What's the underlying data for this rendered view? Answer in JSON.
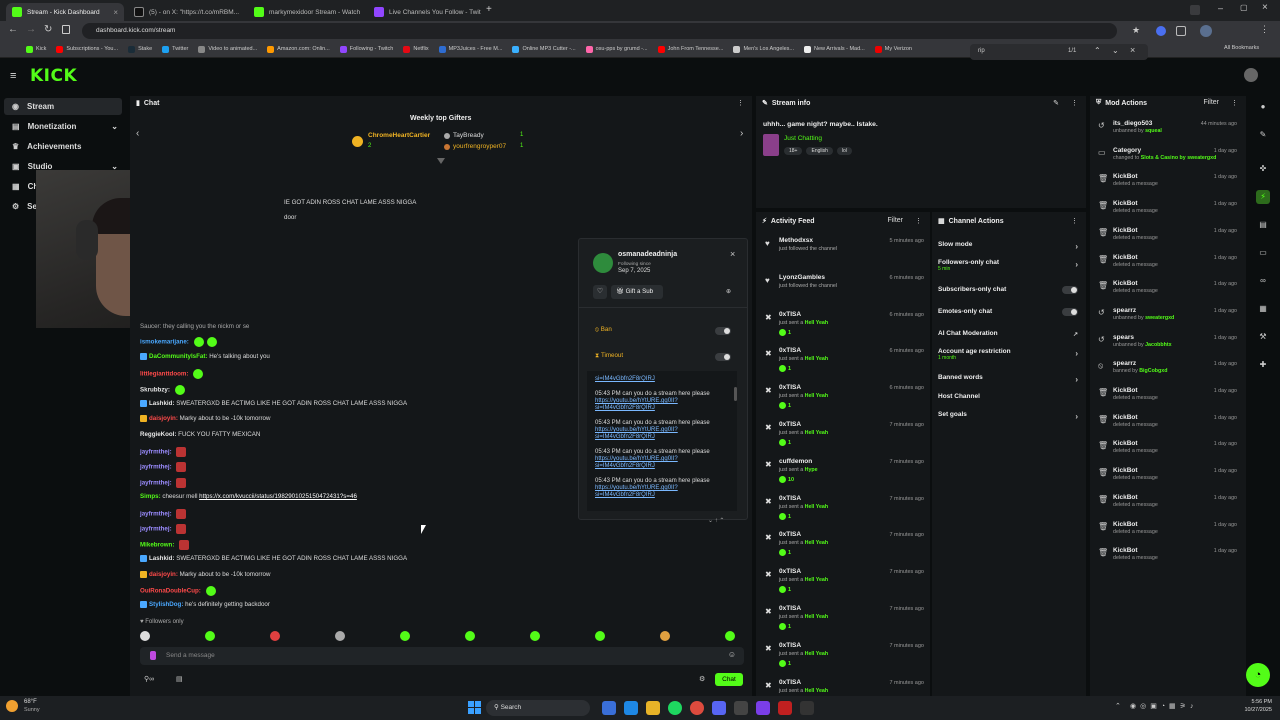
{
  "browser": {
    "tabs": [
      {
        "label": "Stream - Kick Dashboard",
        "color": "#53fc18"
      },
      {
        "label": "(5) - on X: \"https://t.co/mRBM...",
        "color": "#111111"
      },
      {
        "label": "markymexidoor Stream - Watch",
        "color": "#53fc18"
      },
      {
        "label": "Live Channels You Follow - Twit",
        "color": "#9146ff"
      }
    ],
    "url": "dashboard.kick.com/stream",
    "bookmarks": [
      "Kick",
      "Subscriptions - You...",
      "Stake",
      "Twitter",
      "Video to animated...",
      "Amazon.com: Onlin...",
      "Following - Twitch",
      "Netflix",
      "MP3Juices - Free M...",
      "Online MP3 Cutter -...",
      "osu-pps by grumd -...",
      "John From Tennesse...",
      "Men's Los Angeles...",
      "New Arrivals - Mad...",
      "My Verizon"
    ],
    "all_bookmarks": "All Bookmarks",
    "find_query": "rip",
    "find_count": "1/1"
  },
  "app": {
    "logo": "KICK"
  },
  "sidebar": {
    "items": [
      {
        "label": "Stream",
        "icon": "broadcast-icon"
      },
      {
        "label": "Monetization",
        "icon": "dollar-icon"
      },
      {
        "label": "Achievements",
        "icon": "trophy-icon"
      },
      {
        "label": "Studio",
        "icon": "studio-icon"
      },
      {
        "label": "Ch",
        "icon": "channel-icon"
      },
      {
        "label": "Se",
        "icon": "settings-icon"
      }
    ]
  },
  "chat": {
    "title": "Chat",
    "gifters_title": "Weekly top Gifters",
    "gifters": [
      {
        "name": "ChromeHeartCartier",
        "count": "2"
      },
      {
        "name": "TayBready",
        "count": "1"
      },
      {
        "name": "yourfrengroyper07",
        "count": "1"
      }
    ],
    "top_fragment_1": "IE GOT ADIN ROSS CHAT LAME ASSS NIGGA",
    "top_fragment_2": "door",
    "partial_line": "Saucer: they calling you the nickm or se",
    "messages": [
      {
        "user": "ismokemarijane:",
        "text": "",
        "color": "#4aa8ff",
        "emotes": 2
      },
      {
        "user": "DaCommunityIsFat:",
        "text": "He's talking about you",
        "color": "#53fc18",
        "emotes": 0
      },
      {
        "user": "littlegianttdoom:",
        "text": "",
        "color": "#ff4a4a",
        "emotes": 1
      },
      {
        "user": "Skrubbzy:",
        "text": "",
        "color": "#e6e6e6",
        "emotes": 1
      },
      {
        "user": "Lashkid:",
        "text": "SWEATERGXD BE ACTIMG LIKE HE GOT ADIN ROSS CHAT LAME ASSS NIGGA",
        "color": "#e6e6e6",
        "emotes": 0
      },
      {
        "user": "daisjoyin:",
        "text": "Marky about to be -10k tomorrow",
        "color": "#ff4a4a",
        "emotes": 0
      },
      {
        "user": "ReggieKool:",
        "text": "FUCK YOU FATTY MEXICAN",
        "color": "#e6e6e6",
        "emotes": 0
      },
      {
        "user": "jayfrmthej:",
        "text": "",
        "color": "#9b8cff",
        "emotes": 1
      },
      {
        "user": "jayfrmthej:",
        "text": "",
        "color": "#9b8cff",
        "emotes": 1
      },
      {
        "user": "jayfrmthej:",
        "text": "",
        "color": "#9b8cff",
        "emotes": 1
      },
      {
        "user": "Simps:",
        "text": "cheesur mell ",
        "link": "https://x.com/kvuccii/status/1982901025150472431?s=46",
        "color": "#53fc18",
        "emotes": 0
      },
      {
        "user": "jayfrmthej:",
        "text": "",
        "color": "#9b8cff",
        "emotes": 1
      },
      {
        "user": "jayfrmthej:",
        "text": "",
        "color": "#9b8cff",
        "emotes": 1
      },
      {
        "user": "Mikebrown:",
        "text": "",
        "color": "#53fc18",
        "emotes": 1
      },
      {
        "user": "Lashkid:",
        "text": "SWEATERGXD BE ACTIMG LIKE HE GOT ADIN ROSS CHAT LAME ASSS NIGGA",
        "color": "#e6e6e6",
        "emotes": 0
      },
      {
        "user": "daisjoyin:",
        "text": "Marky about to be -10k tomorrow",
        "color": "#ff4a4a",
        "emotes": 0
      },
      {
        "user": "OuiRonaDoubleCup:",
        "text": "",
        "color": "#ff4a4a",
        "emotes": 1
      },
      {
        "user": "StylishDog:",
        "text": "he's definitely getting backdoor",
        "color": "#4aa8ff",
        "emotes": 0
      }
    ],
    "followers_only": "Followers only",
    "input_placeholder": "Send a message",
    "send_label": "Chat"
  },
  "user_card": {
    "username": "osmanadeadninja",
    "following_since_label": "Following since",
    "following_since": "Sep 7, 2025",
    "gift_label": "Gift a Sub",
    "ban_label": "Ban",
    "timeout_label": "Timeout",
    "history": [
      {
        "time": "",
        "text": "",
        "link": "si=IM4vGbfn2F8rQIRJ"
      },
      {
        "time": "05:43 PM",
        "text": "can you do a stream here please ",
        "link": "https://youtu.be/hYtURE.gg0II?si=IM4vGbfn2F8rQIRJ"
      },
      {
        "time": "05:43 PM",
        "text": "can you do a stream here please ",
        "link": "https://youtu.be/hYtURE.gg0II?si=IM4vGbfn2F8rQIRJ"
      },
      {
        "time": "05:43 PM",
        "text": "can you do a stream here please ",
        "link": "https://youtu.be/hYtURE.gg0II?si=IM4vGbfn2F8rQIRJ"
      },
      {
        "time": "05:43 PM",
        "text": "can you do a stream here please ",
        "link": "https://youtu.be/hYtURE.gg0II?si=IM4vGbfn2F8rQIRJ"
      }
    ]
  },
  "stream_info": {
    "title": "Stream info",
    "stream_title": "uhhh... game night? maybe.. Istake.",
    "category": "Just Chatting",
    "tags": [
      "18+",
      "English",
      "lol"
    ]
  },
  "activity": {
    "title": "Activity Feed",
    "filter": "Filter",
    "items": [
      {
        "icon": "heart-icon",
        "name": "Methodxsx",
        "sub": "just followed the channel",
        "time": "5 minutes ago",
        "amount": ""
      },
      {
        "icon": "heart-icon",
        "name": "LyonzGambles",
        "sub": "just followed the channel",
        "time": "6 minutes ago",
        "amount": ""
      },
      {
        "icon": "kick-icon",
        "name": "0xTISA",
        "sub": "just sent a ",
        "emote": "Hell Yeah",
        "time": "6 minutes ago",
        "amount": "1"
      },
      {
        "icon": "kick-icon",
        "name": "0xTISA",
        "sub": "just sent a ",
        "emote": "Hell Yeah",
        "time": "6 minutes ago",
        "amount": "1"
      },
      {
        "icon": "kick-icon",
        "name": "0xTISA",
        "sub": "just sent a ",
        "emote": "Hell Yeah",
        "time": "6 minutes ago",
        "amount": "1"
      },
      {
        "icon": "kick-icon",
        "name": "0xTISA",
        "sub": "just sent a ",
        "emote": "Hell Yeah",
        "time": "7 minutes ago",
        "amount": "1"
      },
      {
        "icon": "kick-icon",
        "name": "cuffdemon",
        "sub": "just sent a ",
        "emote": "Hype",
        "time": "7 minutes ago",
        "amount": "10"
      },
      {
        "icon": "kick-icon",
        "name": "0xTISA",
        "sub": "just sent a ",
        "emote": "Hell Yeah",
        "time": "7 minutes ago",
        "amount": "1"
      },
      {
        "icon": "kick-icon",
        "name": "0xTISA",
        "sub": "just sent a ",
        "emote": "Hell Yeah",
        "time": "7 minutes ago",
        "amount": "1"
      },
      {
        "icon": "kick-icon",
        "name": "0xTISA",
        "sub": "just sent a ",
        "emote": "Hell Yeah",
        "time": "7 minutes ago",
        "amount": "1"
      },
      {
        "icon": "kick-icon",
        "name": "0xTISA",
        "sub": "just sent a ",
        "emote": "Hell Yeah",
        "time": "7 minutes ago",
        "amount": "1"
      },
      {
        "icon": "kick-icon",
        "name": "0xTISA",
        "sub": "just sent a ",
        "emote": "Hell Yeah",
        "time": "7 minutes ago",
        "amount": "1"
      },
      {
        "icon": "kick-icon",
        "name": "0xTISA",
        "sub": "just sent a ",
        "emote": "Hell Yeah",
        "time": "7 minutes ago",
        "amount": "1"
      }
    ]
  },
  "channel_actions": {
    "title": "Channel Actions",
    "items": [
      {
        "label": "Slow mode",
        "sub": "",
        "control": "chevron"
      },
      {
        "label": "Followers-only chat",
        "sub": "5 min",
        "control": "chevron"
      },
      {
        "label": "Subscribers-only chat",
        "sub": "",
        "control": "toggle"
      },
      {
        "label": "Emotes-only chat",
        "sub": "",
        "control": "toggle"
      },
      {
        "label": "AI Chat Moderation",
        "sub": "",
        "control": "link"
      },
      {
        "label": "Account age restriction",
        "sub": "1 month",
        "control": "chevron"
      },
      {
        "label": "Banned words",
        "sub": "",
        "control": "chevron"
      },
      {
        "label": "Host Channel",
        "sub": "",
        "control": "none"
      },
      {
        "label": "Set goals",
        "sub": "",
        "control": "chevron"
      }
    ]
  },
  "mod_actions": {
    "title": "Mod Actions",
    "filter": "Filter",
    "items": [
      {
        "icon": "unban-icon",
        "name": "its_diego503",
        "sub": "unbanned by ",
        "by": "squeal",
        "time": "44 minutes ago"
      },
      {
        "icon": "category-icon",
        "name": "Category",
        "sub": "changed to ",
        "by": "Slots & Casino by sweatergxd",
        "time": "1 day ago"
      },
      {
        "icon": "trash-icon",
        "name": "KickBot",
        "sub": "deleted a message",
        "by": "",
        "time": "1 day ago"
      },
      {
        "icon": "trash-icon",
        "name": "KickBot",
        "sub": "deleted a message",
        "by": "",
        "time": "1 day ago"
      },
      {
        "icon": "trash-icon",
        "name": "KickBot",
        "sub": "deleted a message",
        "by": "",
        "time": "1 day ago"
      },
      {
        "icon": "trash-icon",
        "name": "KickBot",
        "sub": "deleted a message",
        "by": "",
        "time": "1 day ago"
      },
      {
        "icon": "trash-icon",
        "name": "KickBot",
        "sub": "deleted a message",
        "by": "",
        "time": "1 day ago"
      },
      {
        "icon": "unban-icon",
        "name": "spearrz",
        "sub": "unbanned by ",
        "by": "sweatergxd",
        "time": "1 day ago"
      },
      {
        "icon": "unban-icon",
        "name": "spears",
        "sub": "unbanned by ",
        "by": "Jacobbhtx",
        "time": "1 day ago"
      },
      {
        "icon": "ban-icon",
        "name": "spearrz",
        "sub": "banned by ",
        "by": "BigCobgxd",
        "time": "1 day ago"
      },
      {
        "icon": "trash-icon",
        "name": "KickBot",
        "sub": "deleted a message",
        "by": "",
        "time": "1 day ago"
      },
      {
        "icon": "trash-icon",
        "name": "KickBot",
        "sub": "deleted a message",
        "by": "",
        "time": "1 day ago"
      },
      {
        "icon": "trash-icon",
        "name": "KickBot",
        "sub": "deleted a message",
        "by": "",
        "time": "1 day ago"
      },
      {
        "icon": "trash-icon",
        "name": "KickBot",
        "sub": "deleted a message",
        "by": "",
        "time": "1 day ago"
      },
      {
        "icon": "trash-icon",
        "name": "KickBot",
        "sub": "deleted a message",
        "by": "",
        "time": "1 day ago"
      },
      {
        "icon": "trash-icon",
        "name": "KickBot",
        "sub": "deleted a message",
        "by": "",
        "time": "1 day ago"
      },
      {
        "icon": "trash-icon",
        "name": "KickBot",
        "sub": "deleted a message",
        "by": "",
        "time": "1 day ago"
      }
    ]
  },
  "taskbar": {
    "weather_temp": "68°F",
    "weather_desc": "Sunny",
    "search_label": "Search",
    "time": "5:56 PM",
    "date": "10/27/2025"
  },
  "colors": {
    "accent": "#53fc18",
    "panel": "#141719",
    "bg": "#0b0e0f"
  }
}
